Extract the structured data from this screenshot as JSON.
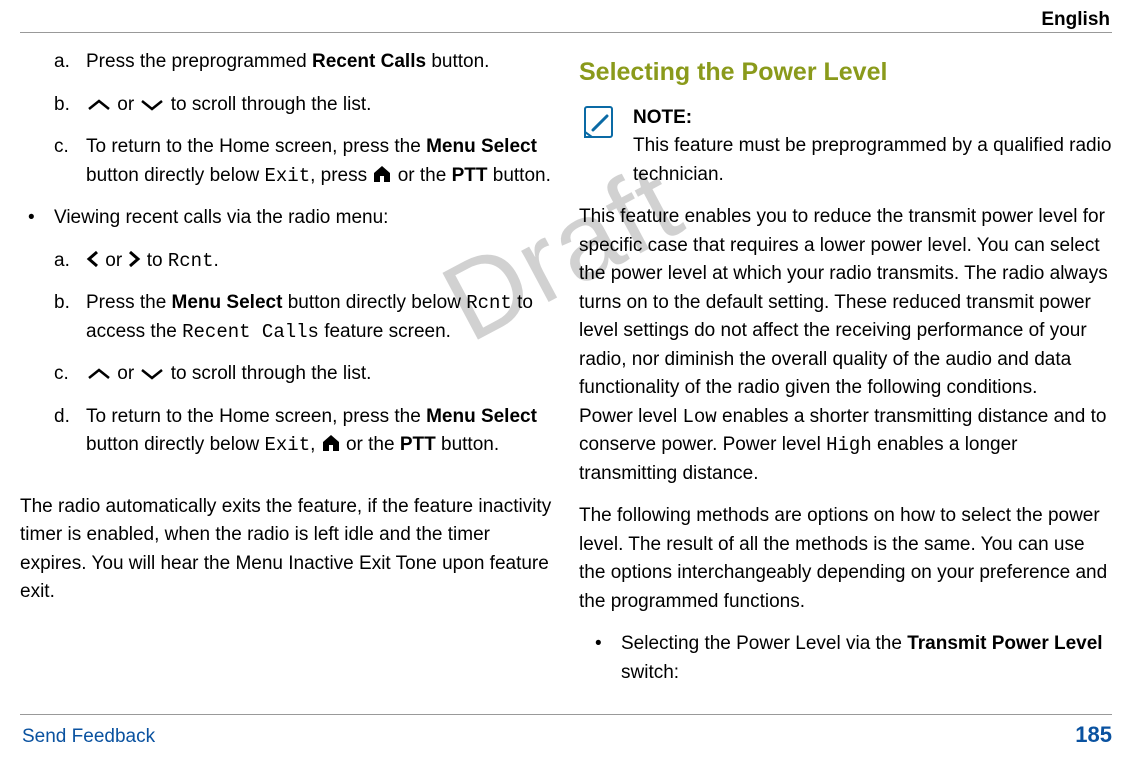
{
  "header": {
    "language": "English"
  },
  "watermark": "Draft",
  "left": {
    "listA": {
      "a": {
        "pre": "Press the preprogrammed ",
        "bold1": "Recent Calls",
        "post": " button."
      },
      "b": {
        "mid": " or ",
        "tail": " to scroll through the list."
      },
      "c": {
        "t1": "To return to the Home screen, press the ",
        "b1": "Menu Select",
        "t2": " button directly below ",
        "m1": "Exit",
        "t3": ", press ",
        "t4": " or the ",
        "b2": "PTT",
        "t5": " button."
      }
    },
    "bullet": {
      "text": "Viewing recent calls via the radio menu:"
    },
    "listB": {
      "a": {
        "t1": "or",
        "t2": "to ",
        "m1": "Rcnt",
        "t3": "."
      },
      "b": {
        "t1": "Press the ",
        "b1": "Menu Select",
        "t2": " button directly below ",
        "m1": "Rcnt",
        "t3": " to access the ",
        "m2": "Recent Calls",
        "t4": " feature screen."
      },
      "c": {
        "mid": " or ",
        "tail": " to scroll through the list."
      },
      "d": {
        "t1": "To return to the Home screen, press the ",
        "b1": "Menu Select",
        "t2": " button directly below ",
        "m1": "Exit",
        "t3": ", ",
        "t4": " or the ",
        "b2": "PTT",
        "t5": " button."
      }
    },
    "closing": "The radio automatically exits the feature, if the feature inactivity timer is enabled, when the radio is left idle and the timer expires. You will hear the Menu Inactive Exit Tone upon feature exit."
  },
  "right": {
    "heading": "Selecting the Power Level",
    "note": {
      "label": "NOTE:",
      "text": "This feature must be preprogrammed by a qualified radio technician."
    },
    "p1a": "This feature enables you to reduce the transmit power level for specific case that requires a lower power level. You can select the power level at which your radio transmits. The radio always turns on to the default setting. These reduced transmit power level settings do not affect the receiving performance of your radio, nor diminish the overall quality of the audio and data functionality of the radio given the following conditions.",
    "p1b_pre": "Power level ",
    "p1b_low": "Low",
    "p1b_mid": " enables a shorter transmitting distance and to conserve power. Power level ",
    "p1b_high": "High",
    "p1b_post": " enables a longer transmitting distance.",
    "p2": "The following methods are options on how to select the power level. The result of all the methods is the same. You can use the options interchangeably depending on your preference and the programmed functions.",
    "bullet": {
      "t1": "Selecting the Power Level via the ",
      "b1": "Transmit Power Level",
      "t2": " switch:"
    }
  },
  "footer": {
    "link": "Send Feedback",
    "page": "185"
  }
}
